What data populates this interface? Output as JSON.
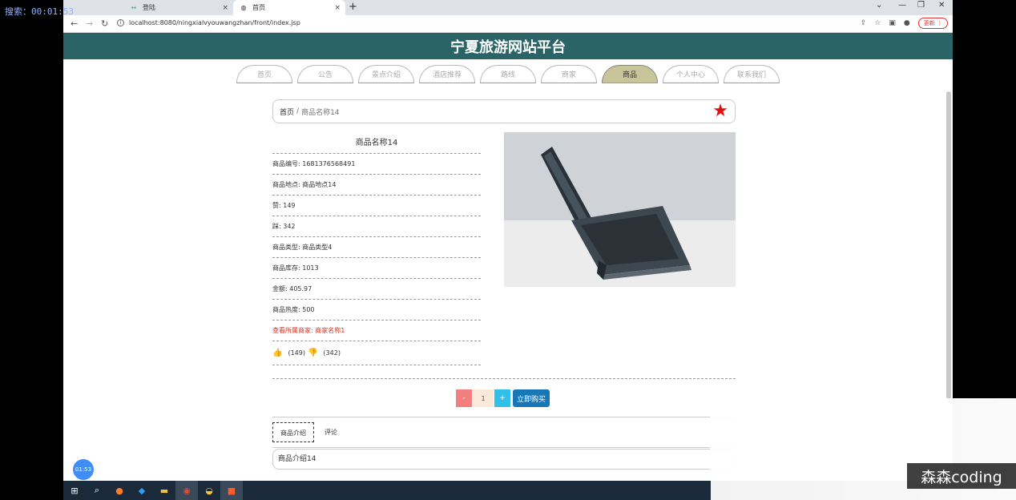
{
  "overlay": {
    "text": "搜索：00:01:53"
  },
  "browser": {
    "tabs": [
      {
        "label": "登陆",
        "close": "×"
      },
      {
        "label": "首页",
        "close": "×"
      }
    ],
    "new_tab": "+",
    "url": "localhost:8080/ningxialvyouwangzhan/front/index.jsp",
    "update_label": "更新 ⋮",
    "window_controls": {
      "min": "—",
      "max": "❐",
      "close": "✕"
    }
  },
  "site": {
    "title": "宁夏旅游网站平台",
    "nav": [
      "首页",
      "公告",
      "景点介绍",
      "酒店推荐",
      "路线",
      "商家",
      "商品",
      "个人中心",
      "联系我们"
    ],
    "active_nav_index": 6
  },
  "breadcrumb": {
    "home": "首页",
    "separator": "/",
    "current": "商品名称14",
    "star": "★"
  },
  "product": {
    "name": "商品名称14",
    "fields": [
      "商品编号: 1681376568491",
      "商品地点: 商品地点14",
      "赞: 149",
      "踩: 342",
      "商品类型: 商品类型4",
      "商品库存: 1013",
      "金额: 405.97",
      "商品热度: 500"
    ],
    "merchant_link": "查看所属商家: 商家名称1",
    "likes": "(149)",
    "dislikes": "(342)"
  },
  "purchase": {
    "minus": "-",
    "qty": "1",
    "plus": "+",
    "buy_label": "立即购买"
  },
  "detail_tabs": {
    "tabs": [
      "商品介绍",
      "评论"
    ],
    "active": 0,
    "content": "商品介绍14"
  },
  "timer": "01:53",
  "watermark": "森森coding"
}
